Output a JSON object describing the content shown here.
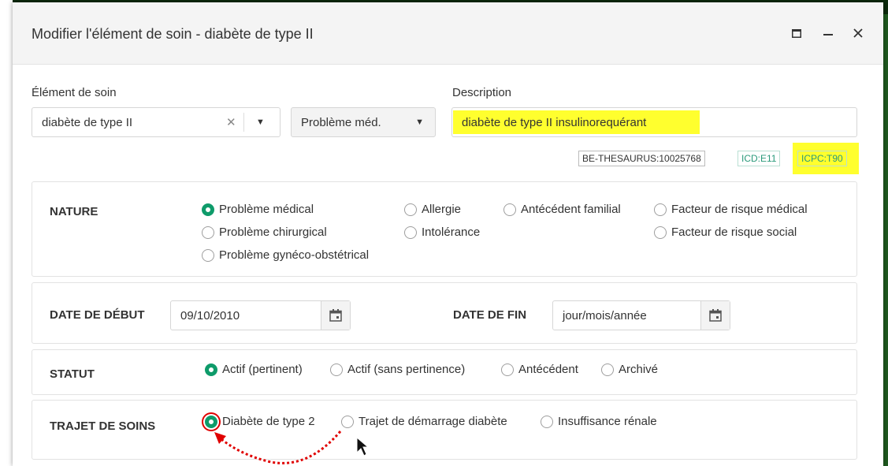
{
  "dialog": {
    "title": "Modifier l'élément de soin - diabète de type II",
    "controls": {
      "maximize": "□",
      "minimize": "–",
      "close": "✕"
    }
  },
  "form": {
    "care_element_label": "Élément de soin",
    "care_element_value": "diabète de type II",
    "clear_glyph": "✕",
    "dropdown_glyph": "▼",
    "type_value": "Problème méd.",
    "description_label": "Description",
    "description_value": "diabète de type II insulinorequérant",
    "codes": [
      "BE-THESAURUS:10025768",
      "ICD:E11",
      "ICPC:T90"
    ]
  },
  "nature": {
    "title": "NATURE",
    "options": [
      {
        "label": "Problème médical",
        "checked": true
      },
      {
        "label": "Problème chirurgical",
        "checked": false
      },
      {
        "label": "Problème gynéco-obstétrical",
        "checked": false
      },
      {
        "label": "Allergie",
        "checked": false
      },
      {
        "label": "Intolérance",
        "checked": false
      },
      {
        "label": "Antécédent familial",
        "checked": false
      },
      {
        "label": "Facteur de risque médical",
        "checked": false
      },
      {
        "label": "Facteur de risque social",
        "checked": false
      }
    ]
  },
  "dates": {
    "start_label": "DATE DE DÉBUT",
    "start_value": "09/10/2010",
    "end_label": "DATE DE FIN",
    "end_value": "jour/mois/année"
  },
  "status": {
    "title": "STATUT",
    "options": [
      {
        "label": "Actif (pertinent)",
        "checked": true
      },
      {
        "label": "Actif (sans pertinence)",
        "checked": false
      },
      {
        "label": "Antécédent",
        "checked": false
      },
      {
        "label": "Archivé",
        "checked": false
      }
    ]
  },
  "care_path": {
    "title": "TRAJET DE SOINS",
    "options": [
      {
        "label": "Diabète de type 2",
        "checked": true
      },
      {
        "label": "Trajet de démarrage diabète",
        "checked": false
      },
      {
        "label": "Insuffisance rénale",
        "checked": false
      }
    ]
  },
  "colors": {
    "accent": "#0e9b6a",
    "highlight": "#ffff2e",
    "annotation": "#e00000"
  },
  "icons": {
    "calendar": "calendar-icon",
    "cursor": "mouse-cursor-icon"
  }
}
